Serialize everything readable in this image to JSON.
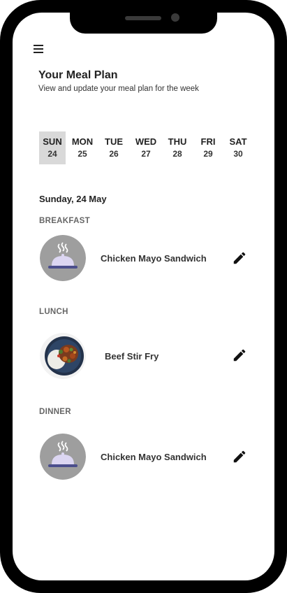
{
  "header": {
    "title": "Your Meal Plan",
    "subtitle": "View and update your meal plan for the week"
  },
  "week": {
    "selected_index": 0,
    "days": [
      {
        "name": "SUN",
        "num": "24"
      },
      {
        "name": "MON",
        "num": "25"
      },
      {
        "name": "TUE",
        "num": "26"
      },
      {
        "name": "WED",
        "num": "27"
      },
      {
        "name": "THU",
        "num": "28"
      },
      {
        "name": "FRI",
        "num": "29"
      },
      {
        "name": "SAT",
        "num": "30"
      }
    ]
  },
  "selected_date": "Sunday, 24 May",
  "meals": [
    {
      "label": "BREAKFAST",
      "name": "Chicken Mayo Sandwich",
      "image_icon": "food-cloche-icon"
    },
    {
      "label": "LUNCH",
      "name": "Beef Stir Fry",
      "image_icon": "stir-fry-photo"
    },
    {
      "label": "DINNER",
      "name": "Chicken Mayo Sandwich",
      "image_icon": "food-cloche-icon"
    }
  ],
  "icons": {
    "menu": "hamburger-menu-icon",
    "edit": "pencil-edit-icon"
  },
  "colors": {
    "selected_day_bg": "#d9d9d9",
    "placeholder_circle": "#9e9e9e",
    "cloche": "#dcd6f2"
  }
}
